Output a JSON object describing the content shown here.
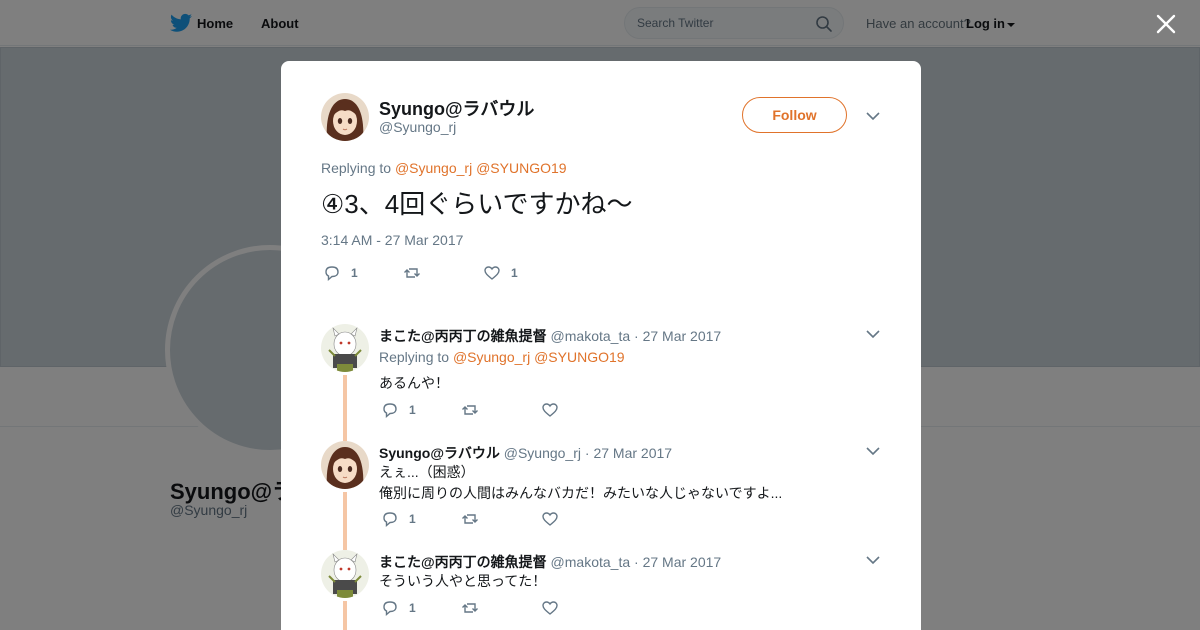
{
  "nav": {
    "home_label": "Home",
    "about_label": "About",
    "search_placeholder": "Search Twitter",
    "have_account": "Have an account?",
    "login_label": "Log in"
  },
  "profile_bg": {
    "name": "Syungo@ラバウル",
    "handle": "@Syungo_rj"
  },
  "tweet": {
    "author_name": "Syungo@ラバウル",
    "author_handle": "@Syungo_rj",
    "follow_label": "Follow",
    "replying_prefix": "Replying to",
    "replying_to": [
      "@Syungo_rj",
      "@SYUNGO19"
    ],
    "text": "④3、4回ぐらいですかね～",
    "timestamp": "3:14 AM - 27 Mar 2017",
    "reply_count": "1",
    "retweet_count": "",
    "like_count": "1"
  },
  "replies": [
    {
      "name": "まこた@丙丙丁の雑魚提督",
      "handle": "@makota_ta",
      "date": "· 27 Mar 2017",
      "replying_prefix": "Replying to",
      "replying_to": [
        "@Syungo_rj",
        "@SYUNGO19"
      ],
      "lines": [
        "あるんや！"
      ],
      "reply_count": "1",
      "like_count": ""
    },
    {
      "name": "Syungo@ラバウル",
      "handle": "@Syungo_rj",
      "date": "· 27 Mar 2017",
      "lines": [
        "えぇ...（困惑）",
        "俺別に周りの人間はみんなバカだ！みたいな人じゃないですよ..."
      ],
      "reply_count": "1",
      "like_count": ""
    },
    {
      "name": "まこた@丙丙丁の雑魚提督",
      "handle": "@makota_ta",
      "date": "· 27 Mar 2017",
      "lines": [
        "そういう人やと思ってた！"
      ],
      "reply_count": "1",
      "like_count": ""
    }
  ],
  "colors": {
    "accent": "#e0732b",
    "twitter_blue": "#1da1f2",
    "muted": "#657786",
    "thread_line": "#f5c6a5"
  }
}
